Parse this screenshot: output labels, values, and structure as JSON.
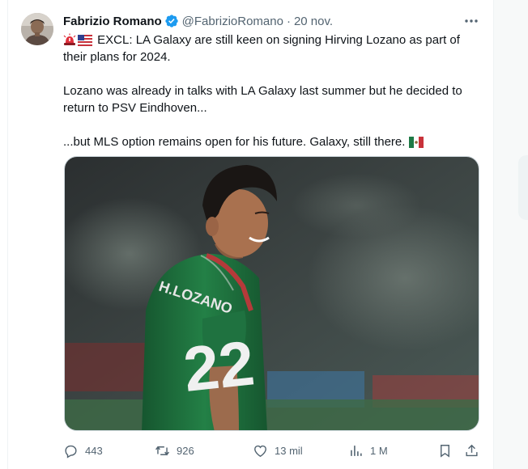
{
  "tweet": {
    "author_name": "Fabrizio Romano",
    "handle": "@FabrizioRomano",
    "separator": "·",
    "date": "20 nov.",
    "paragraphs": [
      {
        "prefix_emojis": [
          "siren-icon",
          "us-flag-icon"
        ],
        "text": "EXCL: LA Galaxy are still keen on signing Hirving Lozano as part of their plans for 2024."
      },
      {
        "text": "Lozano was already in talks with LA Galaxy last summer but he decided to return to PSV Eindhoven..."
      },
      {
        "text": "...but MLS option remains open for his future. Galaxy, still there.",
        "suffix_emoji": "mexico-flag-icon"
      }
    ],
    "media": {
      "shirt_text": "H.LOZANO",
      "shirt_number": "22"
    },
    "actions": {
      "replies": "443",
      "reposts": "926",
      "likes": "13 mil",
      "views": "1 M"
    },
    "colors": {
      "verified": "#1d9bf0",
      "text": "#0f1419",
      "muted": "#536471",
      "jersey_green": "#1d6b3a"
    }
  }
}
